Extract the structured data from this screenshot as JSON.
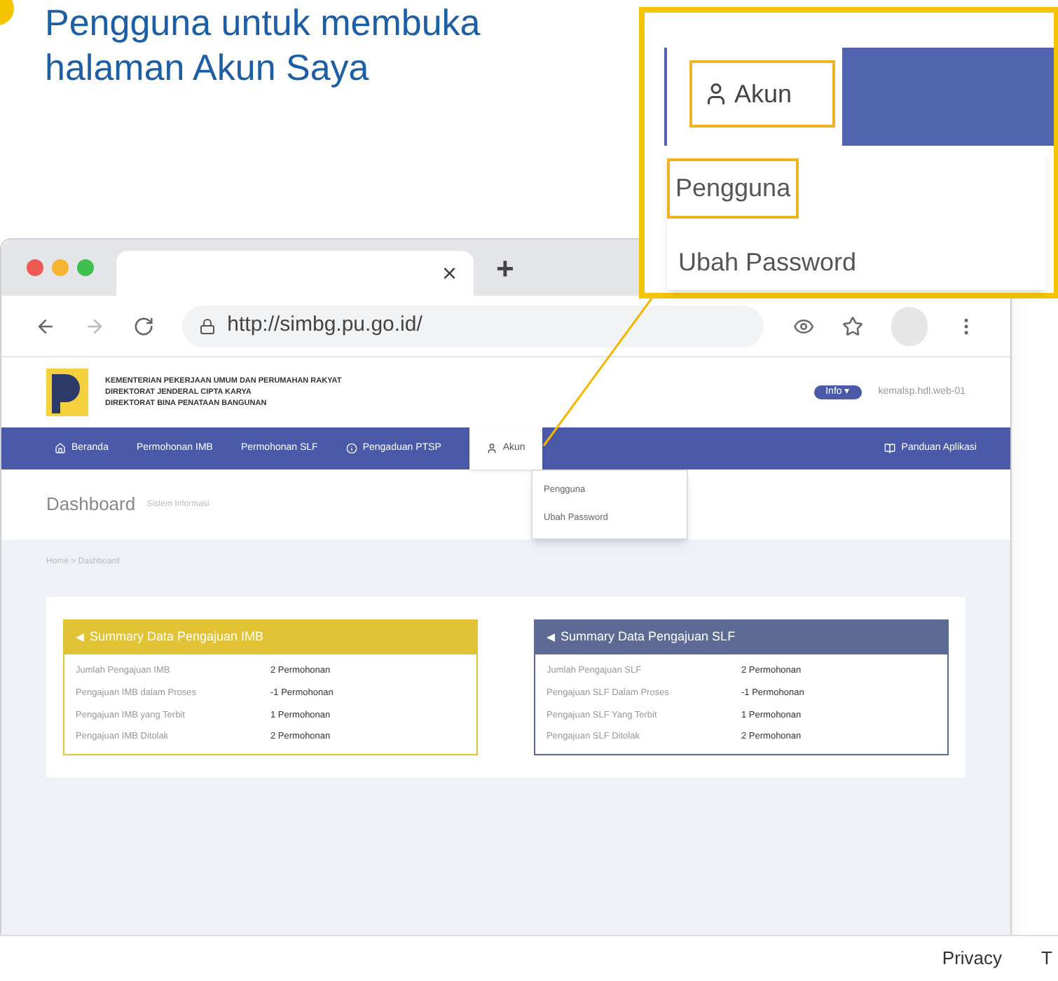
{
  "caption": {
    "lines": [
      "Pengguna untuk membuka",
      "halaman Akun Saya"
    ]
  },
  "browser": {
    "tab_close": "×",
    "new_tab": "+",
    "url": "http://simbg.pu.go.id/"
  },
  "site": {
    "header_lines": [
      "KEMENTERIAN PEKERJAAN UMUM DAN PERUMAHAN RAKYAT",
      "DIREKTORAT JENDERAL CIPTA KARYA",
      "DIREKTORAT BINA PENATAAN BANGUNAN"
    ],
    "badge": "Info ▾",
    "user": "kemalsp.hdl.web-01",
    "nav": [
      {
        "label": "Beranda",
        "selected": false
      },
      {
        "label": "Permohonan IMB",
        "selected": false
      },
      {
        "label": "Permohonan SLF",
        "selected": false
      },
      {
        "label": "Pengaduan PTSP",
        "selected": false
      },
      {
        "label": "Akun",
        "selected": true
      }
    ],
    "nav_right": "Panduan Aplikasi",
    "menu": [
      "Pengguna",
      "Ubah Password"
    ],
    "page_title": "Dashboard",
    "page_subtitle": "Sistem Informasi",
    "breadcrumb": "Home > Dashboard",
    "cards": [
      {
        "title": "Summary Data Pengajuan IMB",
        "color": "#e2c336",
        "rows": [
          [
            "Jumlah Pengajuan IMB",
            "2 Permohonan"
          ],
          [
            "Pengajuan IMB dalam Proses",
            "-1 Permohonan"
          ],
          [
            "Pengajuan IMB yang Terbit",
            "1 Permohonan"
          ],
          [
            "Pengajuan IMB Ditolak",
            "2 Permohonan"
          ]
        ]
      },
      {
        "title": "Summary Data Pengajuan SLF",
        "color": "#5d6a94",
        "rows": [
          [
            "Jumlah Pengajuan SLF",
            "2 Permohonan"
          ],
          [
            "Pengajuan SLF Dalam Proses",
            "-1 Permohonan"
          ],
          [
            "Pengajuan SLF Yang Terbit",
            "1 Permohonan"
          ],
          [
            "Pengajuan SLF Ditolak",
            "2 Permohonan"
          ]
        ]
      }
    ],
    "footer": [
      "Privacy",
      "T"
    ]
  },
  "callout": {
    "tab": "Akun",
    "items": [
      {
        "label": "Pengguna",
        "highlighted": true
      },
      {
        "label": "Ubah Password",
        "highlighted": false
      }
    ]
  }
}
